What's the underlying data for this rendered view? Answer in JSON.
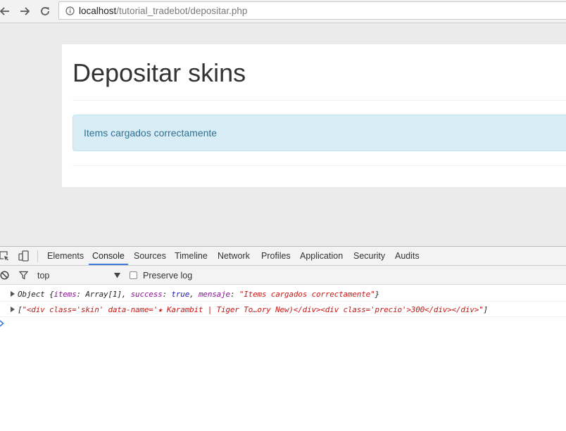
{
  "browser": {
    "url_host": "localhost",
    "url_path": "/tutorial_tradebot/depositar.php"
  },
  "page": {
    "title": "Depositar skins",
    "alert_text": "Items cargados correctamente"
  },
  "devtools": {
    "tabs": [
      "Elements",
      "Console",
      "Sources",
      "Timeline",
      "Network",
      "Profiles",
      "Application",
      "Security",
      "Audits"
    ],
    "active_tab": "Console",
    "context": "top",
    "preserve_log_label": "Preserve log",
    "preserve_log_checked": false,
    "log1": {
      "prefix": "Object {",
      "k1": "items",
      "v1": ": Array[1], ",
      "k2": "success",
      "sep2": ": ",
      "v2": "true",
      "sep3": ", ",
      "k3": "mensaje",
      "sep4": ": ",
      "v3": "\"Items cargados correctamente\"",
      "suffix": "}"
    },
    "log2": {
      "open": "[",
      "string": "\"<div class='skin' data-name='★ Karambit | Tiger To…ory New)</div><div class='precio'>300</div></div>\"",
      "close": "]"
    }
  },
  "colors": {
    "alert_bg": "#d9edf7",
    "alert_text": "#31708f",
    "active_tab_accent": "#3879d9",
    "string": "#c41a16",
    "key": "#881391",
    "boolean": "#1a1aa6"
  },
  "icons": [
    "back-arrow-icon",
    "forward-arrow-icon",
    "reload-icon",
    "info-icon",
    "inspect-icon",
    "device-toolbar-icon",
    "clear-console-icon",
    "filter-icon",
    "dropdown-arrow-icon",
    "expand-triangle-icon",
    "prompt-icon"
  ]
}
